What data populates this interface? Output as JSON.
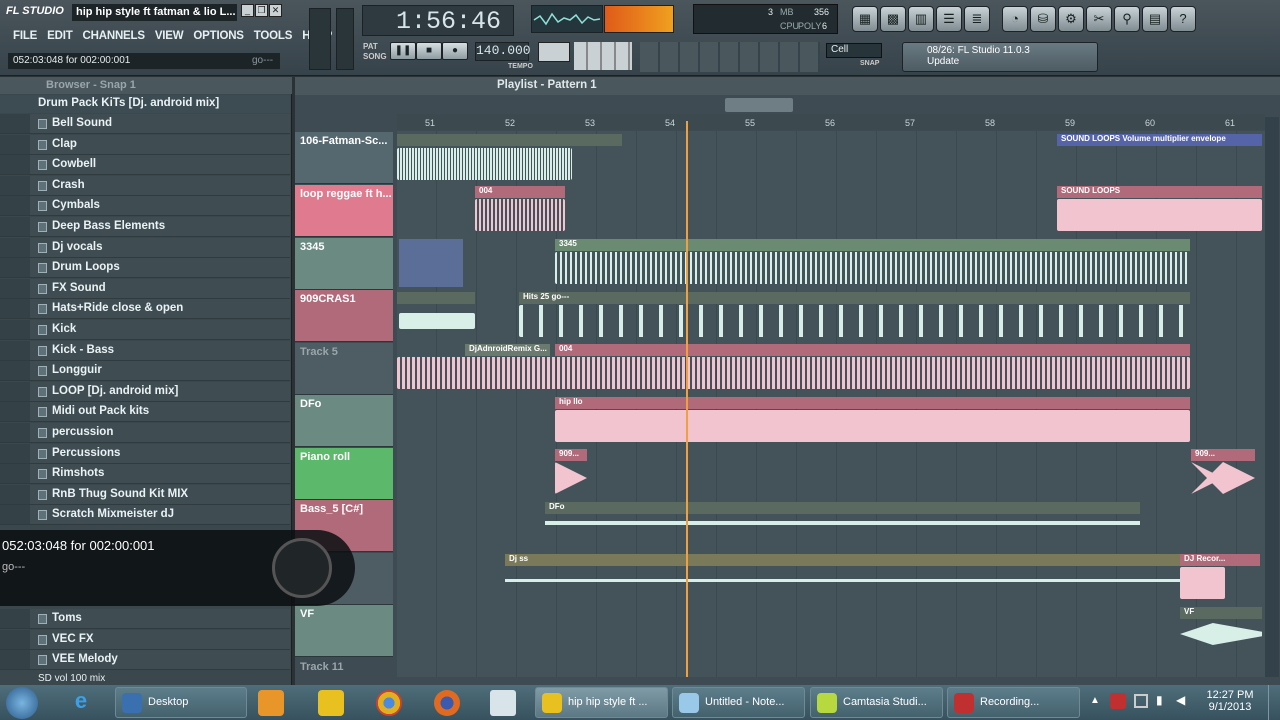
{
  "app": {
    "logo": "FL STUDIO",
    "song_title": "hip hip style ft fatman & lio L...",
    "minimize": "_",
    "restore": "❐",
    "close": "✕"
  },
  "menu": [
    "FILE",
    "EDIT",
    "CHANNELS",
    "VIEW",
    "OPTIONS",
    "TOOLS",
    "HELP"
  ],
  "hint": {
    "text": "052:03:048 for 002:00:001",
    "go": "go---"
  },
  "transport": {
    "time": "1:56:46",
    "tempo": "140.000",
    "pat": "PAT",
    "song": "SONG",
    "tempo_label": "TEMPO",
    "mem": "3",
    "poly": "6",
    "cpu": "356",
    "stats_labels": [
      "MB",
      "CPU",
      "POLY"
    ],
    "snap_value": "Cell",
    "snap_label": "SNAP"
  },
  "news": {
    "line1": "08/26: FL Studio 11.0.3",
    "line2": "Update"
  },
  "browser": {
    "title": "Browser - Snap 1",
    "root": "Drum Pack KiTs [Dj. android mix]",
    "items": [
      "Bell Sound",
      "Clap",
      "Cowbell",
      "Crash",
      "Cymbals",
      "Deep Bass Elements",
      "Dj vocals",
      "Drum Loops",
      "FX Sound",
      "Hats+Ride close & open",
      "Kick",
      "Kick - Bass",
      "Longguir",
      "LOOP [Dj. android mix]",
      "Midi out Pack kits",
      "percussion",
      "Percussions",
      "Rimshots",
      "RnB Thug Sound Kit MIX",
      "Scratch Mixmeister dJ",
      "Toms",
      "VEC FX",
      "VEE Melody",
      "SD vol 100 mix"
    ]
  },
  "playlist": {
    "title": "Playlist - Pattern 1",
    "bars": [
      "51",
      "52",
      "53",
      "54",
      "55",
      "56",
      "57",
      "58",
      "59",
      "60",
      "61"
    ],
    "tracks": [
      {
        "name": "106-Fatman-Sc...",
        "color": "#55676f"
      },
      {
        "name": "loop reggae ft h...",
        "color": "#e07a8e"
      },
      {
        "name": "3345",
        "color": "#6a8a82"
      },
      {
        "name": "909CRAS1",
        "color": "#b06a7a"
      },
      {
        "name": "Track 5",
        "color": "#4e5d63"
      },
      {
        "name": "DFo",
        "color": "#6a8a82"
      },
      {
        "name": "Piano roll",
        "color": "#5cb86a"
      },
      {
        "name": "Bass_5 [C#]",
        "color": "#b06a7a"
      },
      {
        "name": "",
        "color": "#4e5d63"
      },
      {
        "name": "VF",
        "color": "#6a8a82"
      }
    ],
    "track11": "Track 11",
    "clip_labels": {
      "sound_loops_env": "SOUND LOOPS Volume multiplier envelope",
      "sound_loops": "SOUND LOOPS",
      "c004": "004",
      "c3345": "3345",
      "hits": "Hits 25",
      "go": "go---",
      "djremix": "DjAdnroidRemix G...",
      "hiplio": "hip llo",
      "c909": "909...",
      "dfo": "DFo",
      "djss": "Dj ss",
      "djrecor": "DJ Recor...",
      "vf": "VF"
    }
  },
  "popup": {
    "line1": "052:03:048 for 002:00:001",
    "line2": "go---"
  },
  "taskbar": {
    "tasks": [
      "Desktop",
      "hip hip style ft ...",
      "Untitled - Note...",
      "Camtasia Studi...",
      "Recording..."
    ],
    "time": "12:27 PM",
    "date": "9/1/2013"
  }
}
